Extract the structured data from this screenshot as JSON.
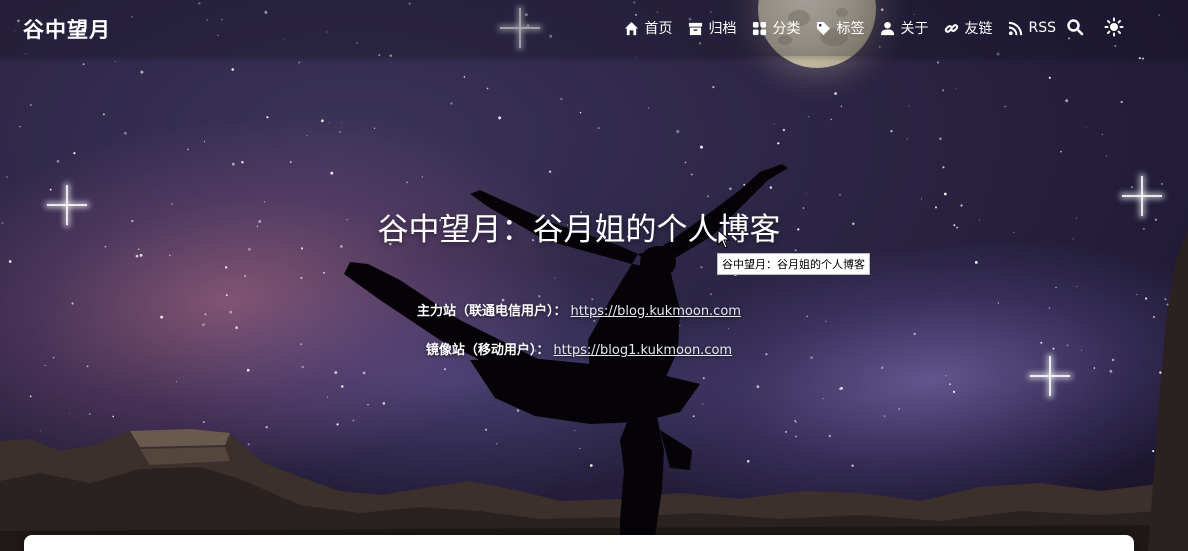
{
  "brand": {
    "title": "谷中望月"
  },
  "nav": {
    "items": [
      {
        "label": "首页",
        "icon": "home-icon"
      },
      {
        "label": "归档",
        "icon": "archive-icon"
      },
      {
        "label": "分类",
        "icon": "category-icon"
      },
      {
        "label": "标签",
        "icon": "tags-icon"
      },
      {
        "label": "关于",
        "icon": "user-icon"
      },
      {
        "label": "友链",
        "icon": "link-icon"
      },
      {
        "label": "RSS",
        "icon": "rss-icon"
      }
    ],
    "search_icon": "search-icon",
    "theme_icon": "sun-icon"
  },
  "hero": {
    "title": "谷中望月：谷月姐的个人博客",
    "tooltip": "谷中望月：谷月姐的个人博客",
    "lines": [
      {
        "label": "主力站（联通电信用户）：",
        "url": "https://blog.kukmoon.com"
      },
      {
        "label": "镜像站（移动用户）：",
        "url": "https://blog1.kukmoon.com"
      }
    ]
  },
  "colors": {
    "text": "#ffffff",
    "sky_dark": "#221c38",
    "glow_pink": "#c47896",
    "glow_purple": "#9682d2",
    "card": "#ffffff"
  }
}
